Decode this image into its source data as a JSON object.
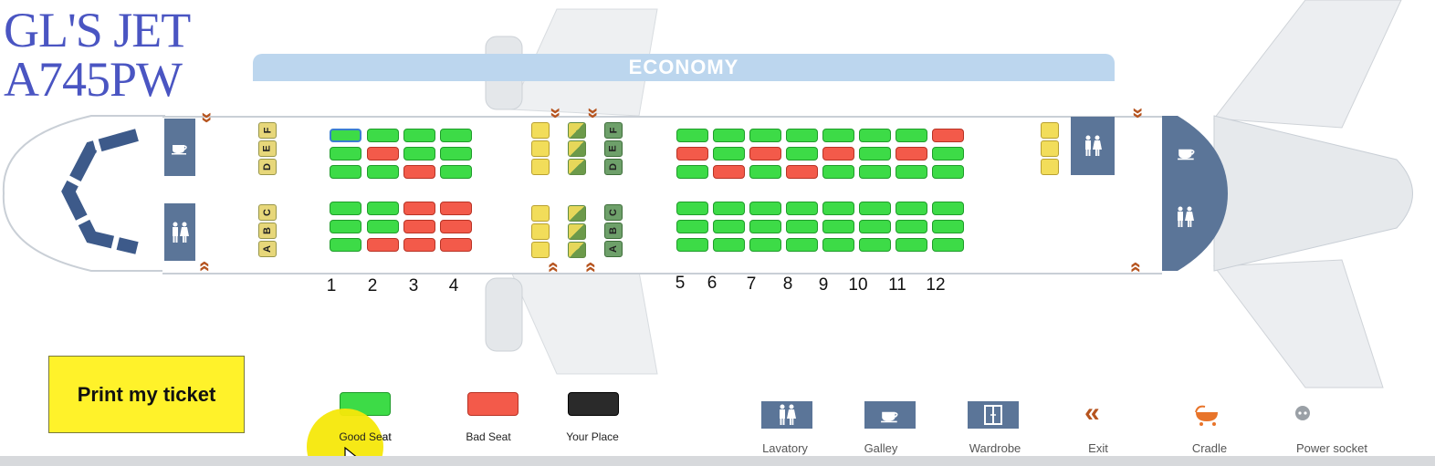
{
  "aircraft": {
    "line1": "GL'S JET",
    "line2": "A745PW"
  },
  "cabin": {
    "label": "ECONOMY"
  },
  "row_numbers": [
    "1",
    "2",
    "3",
    "4",
    "5",
    "6",
    "7",
    "8",
    "9",
    "10",
    "11",
    "12"
  ],
  "seat_letters": {
    "upper": [
      "F",
      "E",
      "D"
    ],
    "lower": [
      "C",
      "B",
      "A"
    ]
  },
  "seats": {
    "front_upper": [
      [
        "mine",
        "good",
        "good",
        "good"
      ],
      [
        "good",
        "bad",
        "good",
        "good"
      ],
      [
        "good",
        "good",
        "bad",
        "good"
      ]
    ],
    "front_lower": [
      [
        "good",
        "good",
        "bad",
        "bad"
      ],
      [
        "good",
        "good",
        "bad",
        "bad"
      ],
      [
        "good",
        "bad",
        "bad",
        "bad"
      ]
    ],
    "rear_upper": [
      [
        "good",
        "good",
        "good",
        "good",
        "good",
        "good",
        "good",
        "bad"
      ],
      [
        "bad",
        "good",
        "bad",
        "good",
        "bad",
        "good",
        "bad",
        "good"
      ],
      [
        "good",
        "bad",
        "good",
        "bad",
        "good",
        "good",
        "good",
        "good"
      ]
    ],
    "rear_lower": [
      [
        "good",
        "good",
        "good",
        "good",
        "good",
        "good",
        "good",
        "good"
      ],
      [
        "good",
        "good",
        "good",
        "good",
        "good",
        "good",
        "good",
        "good"
      ],
      [
        "good",
        "good",
        "good",
        "good",
        "good",
        "good",
        "good",
        "good"
      ]
    ]
  },
  "buttons": {
    "print": "Print my ticket"
  },
  "legend": {
    "seats": [
      {
        "label": "Good Seat",
        "color": "#3ddb47"
      },
      {
        "label": "Bad Seat",
        "color": "#f35a4a"
      },
      {
        "label": "Your Place",
        "color": "#2a2a2a"
      }
    ],
    "amenities": [
      {
        "label": "Lavatory",
        "icon": "lavatory-icon"
      },
      {
        "label": "Galley",
        "icon": "galley-icon"
      },
      {
        "label": "Wardrobe",
        "icon": "wardrobe-icon"
      },
      {
        "label": "Exit",
        "icon": "exit-icon"
      },
      {
        "label": "Cradle",
        "icon": "cradle-icon"
      },
      {
        "label": "Power socket",
        "icon": "power-socket-icon"
      }
    ]
  },
  "colors": {
    "good": "#3ddb47",
    "bad": "#f35a4a",
    "title": "#4a55c2",
    "amenity": "#5b7598",
    "exit": "#b6541f",
    "print_button": "#fff22a"
  }
}
